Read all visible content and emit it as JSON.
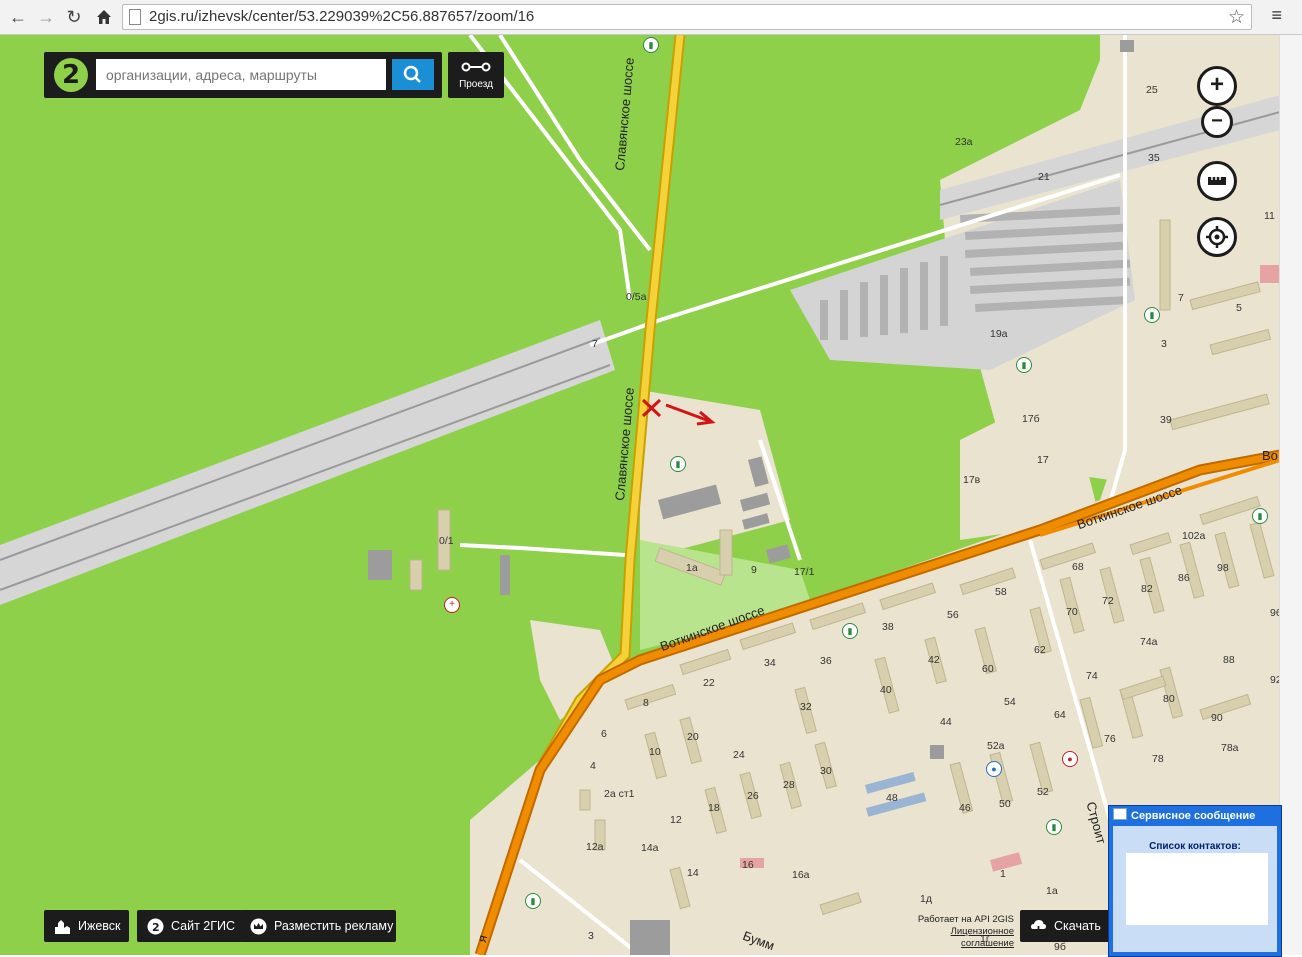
{
  "browser": {
    "url": "2gis.ru/izhevsk/center/53.229039%2C56.887657/zoom/16",
    "icons": [
      "back-arrow-icon",
      "forward-arrow-icon",
      "reload-icon",
      "home-icon",
      "page-icon",
      "bookmark-star-icon",
      "menu-icon"
    ]
  },
  "search": {
    "placeholder": "организации, адреса, маршруты",
    "route_label": "Проезд"
  },
  "map": {
    "streets": {
      "slavyanskoe_1": "Славянское шоссе",
      "slavyanskoe_2": "Славянское шоссе",
      "votkinskoe_1": "Воткинское шоссе",
      "votkinskoe_2": "Воткинское шоссе",
      "stroit": "Строит",
      "bumm": "Бумм",
      "vo": "Во",
      "ya": "я"
    },
    "house_numbers": {
      "n25": "25",
      "n23a": "23а",
      "n21": "21",
      "n35": "35",
      "n11": "11",
      "n7a": "7",
      "n5": "5",
      "n3": "3",
      "n19a": "19а",
      "n0_5a": "0/5а",
      "n7": "7",
      "n17b": "17б",
      "n39": "39",
      "n17": "17",
      "n17v": "17в",
      "n0_1": "0/1",
      "n1a": "1а",
      "n9": "9",
      "n17_1": "17/1",
      "n102a": "102а",
      "n68": "68",
      "n98": "98",
      "n86": "86",
      "n82": "82",
      "n72": "72",
      "n70": "70",
      "n96": "96",
      "n58": "58",
      "n56": "56",
      "n38": "38",
      "n36": "36",
      "n42": "42",
      "n60": "60",
      "n62": "62",
      "n34": "34",
      "n22": "22",
      "n8": "8",
      "n40": "40",
      "n54": "54",
      "n64": "64",
      "n74": "74",
      "n74a": "74а",
      "n88": "88",
      "n92": "92",
      "n80": "80",
      "n90": "90",
      "n32": "32",
      "n44": "44",
      "n6": "6",
      "n20": "20",
      "n10": "10",
      "n24": "24",
      "n52a": "52а",
      "n76": "76",
      "n78": "78",
      "n78a": "78а",
      "n4": "4",
      "n30": "30",
      "n28": "28",
      "n2act1": "2а ст1",
      "n26": "26",
      "n18": "18",
      "n48": "48",
      "n46": "46",
      "n50": "50",
      "n52": "52",
      "n12": "12",
      "n12a": "12а",
      "n14a": "14а",
      "n16": "16",
      "n14": "14",
      "n16a": "16а",
      "n1": "1",
      "n1a_b": "1а",
      "n1d": "1д",
      "n3b": "3",
      "n9b": "9б",
      "n1g": "1г"
    }
  },
  "controls": {
    "zoom_in": "+",
    "zoom_out": "−"
  },
  "footer": {
    "city": "Ижевск",
    "site": "Сайт 2ГИС",
    "ads": "Разместить рекламу",
    "api_works": "Работает на API 2GIS",
    "license": "Лицензионное соглашение",
    "download": "Скачать"
  },
  "service_window": {
    "title": "Сервисное сообщение",
    "contacts_label": "Список контактов:"
  },
  "colors": {
    "map_green": "#8ed04a",
    "road_orange": "#f08c00",
    "road_yellow": "#f6d23a",
    "annotation_red": "#d21414",
    "search_blue": "#1a8fd6"
  }
}
